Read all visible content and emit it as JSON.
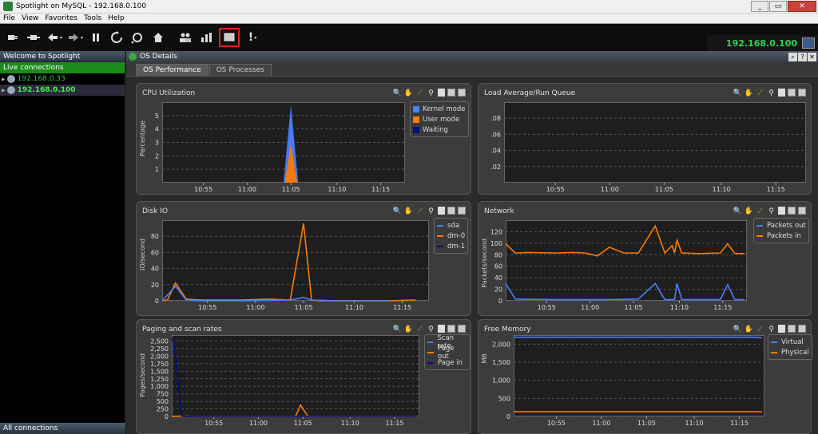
{
  "window": {
    "title": "Spotlight on MySQL - 192.168.0.100",
    "min": "_",
    "max": "▭",
    "close": "✕"
  },
  "menu": [
    "File",
    "View",
    "Favorites",
    "Tools",
    "Help"
  ],
  "toolbar": {
    "ip": "192.168.0.100"
  },
  "sidebar": {
    "header": "Welcome to Spotlight",
    "live": "Live connections",
    "connections": [
      "192.168.0.33",
      "192.168.0.100"
    ],
    "footer": "All connections"
  },
  "main": {
    "header": "OS Details",
    "tabs": [
      "OS Performance",
      "OS Processes"
    ]
  },
  "colors": {
    "blue": "#4a7fff",
    "orange": "#ff7a00",
    "navy": "#00107f",
    "green": "#32d24a"
  },
  "panels": {
    "cpu": {
      "title": "CPU Utilization",
      "ylabel": "Percentage",
      "legend": [
        "Kernel mode",
        "User mode",
        "Waiting"
      ]
    },
    "load": {
      "title": "Load Average/Run Queue",
      "ylabel": "",
      "legend": []
    },
    "disk": {
      "title": "Disk IO",
      "ylabel": "IO/second",
      "legend": [
        "sda",
        "dm-0",
        "dm-1"
      ]
    },
    "net": {
      "title": "Network",
      "ylabel": "Packets/second",
      "legend": [
        "Packets out",
        "Packets in"
      ]
    },
    "paging": {
      "title": "Paging and scan rates",
      "ylabel": "Pages/second",
      "legend": [
        "Scan rate",
        "Page out",
        "Page in"
      ]
    },
    "mem": {
      "title": "Free Memory",
      "ylabel": "MB",
      "legend": [
        "Virtual",
        "Physical"
      ]
    }
  },
  "chart_data": [
    {
      "type": "area",
      "title": "CPU Utilization",
      "ylabel": "Percentage",
      "ylim": [
        0,
        6
      ],
      "yticks": [
        "1",
        "2",
        "3",
        "4",
        "5"
      ],
      "xticks": [
        "10:55",
        "11:00",
        "11:05",
        "11:10",
        "11:15"
      ],
      "xlim": [
        0,
        100
      ],
      "series": [
        {
          "name": "Kernel mode",
          "x": [
            50,
            53,
            56
          ],
          "values": [
            0,
            5.8,
            0
          ]
        },
        {
          "name": "User mode",
          "x": [
            50.5,
            53,
            55.5
          ],
          "values": [
            0,
            2.9,
            0
          ]
        }
      ]
    },
    {
      "type": "line",
      "title": "Load Average/Run Queue",
      "ylim": [
        0,
        0.1
      ],
      "yticks": [
        ".02",
        ".04",
        ".06",
        ".08"
      ],
      "xticks": [
        "10:55",
        "11:00",
        "11:05",
        "11:10",
        "11:15"
      ],
      "xlim": [
        0,
        100
      ],
      "series": []
    },
    {
      "type": "line",
      "title": "Disk IO",
      "ylabel": "IO/second",
      "ylim": [
        0,
        100
      ],
      "yticks": [
        "0",
        "20",
        "40",
        "60",
        "80"
      ],
      "xticks": [
        "10:55",
        "11:00",
        "11:05",
        "11:10",
        "11:15"
      ],
      "xlim": [
        0,
        100
      ],
      "series": [
        {
          "name": "dm-0",
          "x": [
            0,
            2,
            5,
            9,
            14,
            20,
            30,
            40,
            48,
            53,
            56,
            59,
            66,
            75,
            85,
            95
          ],
          "values": [
            0,
            1,
            22,
            2,
            1,
            1,
            1,
            2,
            1,
            96,
            1,
            0,
            0,
            0,
            0,
            1
          ]
        },
        {
          "name": "sda",
          "x": [
            0,
            5,
            9,
            14,
            30,
            48,
            53,
            56,
            66,
            85
          ],
          "values": [
            0,
            18,
            1,
            0,
            0,
            1,
            4,
            1,
            0,
            0
          ]
        }
      ]
    },
    {
      "type": "line",
      "title": "Network",
      "ylabel": "Packets/second",
      "ylim": [
        0,
        140
      ],
      "yticks": [
        "0",
        "20",
        "40",
        "60",
        "80",
        "100",
        "120"
      ],
      "xticks": [
        "10:55",
        "11:00",
        "11:05",
        "11:10",
        "11:15"
      ],
      "xlim": [
        0,
        100
      ],
      "series": [
        {
          "name": "Packets in",
          "x": [
            0,
            4,
            10,
            20,
            28,
            33,
            38,
            43,
            49,
            55,
            62,
            66,
            69,
            70,
            71,
            73,
            74,
            80,
            89,
            92,
            95,
            99
          ],
          "values": [
            99,
            83,
            84,
            83,
            84,
            83,
            78,
            93,
            83,
            83,
            130,
            83,
            96,
            83,
            105,
            83,
            83,
            82,
            83,
            99,
            82,
            82
          ]
        },
        {
          "name": "Packets out",
          "x": [
            0,
            4,
            20,
            40,
            55,
            62,
            66,
            70,
            71,
            73,
            80,
            89,
            92,
            95,
            99
          ],
          "values": [
            30,
            3,
            2,
            2,
            3,
            30,
            2,
            2,
            30,
            2,
            2,
            2,
            28,
            2,
            2
          ]
        }
      ]
    },
    {
      "type": "line",
      "title": "Paging and scan rates",
      "ylabel": "Pages/second",
      "ylim": [
        0,
        2700
      ],
      "yticks": [
        "0",
        "250",
        "500",
        "750",
        "1,000",
        "1,250",
        "1,500",
        "1,750",
        "2,000",
        "2,250",
        "2,500"
      ],
      "xticks": [
        "10:55",
        "11:00",
        "11:05",
        "11:10",
        "11:15"
      ],
      "xlim": [
        0,
        100
      ],
      "series": [
        {
          "name": "Page out",
          "x": [
            0,
            5,
            10,
            30,
            50,
            52,
            55,
            62,
            80,
            99
          ],
          "values": [
            0,
            20,
            0,
            0,
            0,
            380,
            0,
            0,
            0,
            0
          ]
        },
        {
          "name": "Page in",
          "x": [
            0,
            1,
            4,
            8,
            30,
            60,
            99
          ],
          "values": [
            2600,
            2400,
            20,
            0,
            0,
            0,
            0
          ]
        }
      ]
    },
    {
      "type": "line",
      "title": "Free Memory",
      "ylabel": "MB",
      "ylim": [
        0,
        2250
      ],
      "yticks": [
        "0",
        "500",
        "1,000",
        "1,500",
        "2,000"
      ],
      "xticks": [
        "10:55",
        "11:00",
        "11:05",
        "11:10",
        "11:15"
      ],
      "xlim": [
        0,
        100
      ],
      "series": [
        {
          "name": "Virtual",
          "x": [
            0,
            90,
            97,
            99
          ],
          "values": [
            2190,
            2190,
            2190,
            2170
          ]
        },
        {
          "name": "Physical",
          "x": [
            0,
            90,
            97,
            99
          ],
          "values": [
            130,
            130,
            130,
            130
          ]
        }
      ]
    }
  ]
}
